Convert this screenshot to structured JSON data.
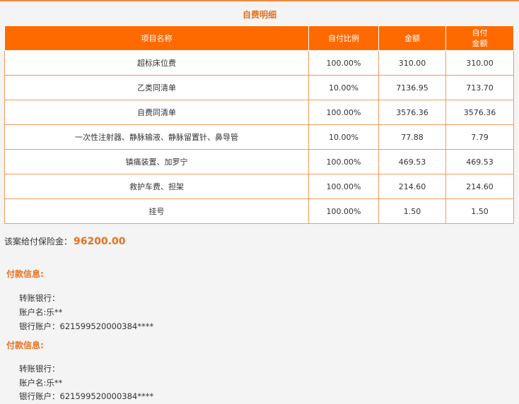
{
  "section_title": "自费明细",
  "table": {
    "headers": {
      "item": "项目名称",
      "ratio": "自付比例",
      "amount": "金额",
      "self_pay_line1": "自付",
      "self_pay_line2": "金额"
    },
    "rows": [
      {
        "item": "超标床位费",
        "ratio": "100.00%",
        "amount": "310.00",
        "self_pay": "310.00"
      },
      {
        "item": "乙类同清单",
        "ratio": "10.00%",
        "amount": "7136.95",
        "self_pay": "713.70"
      },
      {
        "item": "自费同清单",
        "ratio": "100.00%",
        "amount": "3576.36",
        "self_pay": "3576.36"
      },
      {
        "item": "一次性注射器、静脉输液、静脉留置针、鼻导管",
        "ratio": "10.00%",
        "amount": "77.88",
        "self_pay": "7.79"
      },
      {
        "item": "镇痛装置、加罗宁",
        "ratio": "100.00%",
        "amount": "469.53",
        "self_pay": "469.53"
      },
      {
        "item": "救护车费、担架",
        "ratio": "100.00%",
        "amount": "214.60",
        "self_pay": "214.60"
      },
      {
        "item": "挂号",
        "ratio": "100.00%",
        "amount": "1.50",
        "self_pay": "1.50"
      }
    ]
  },
  "payout": {
    "label": "该案给付保险金：",
    "amount": "96200.00"
  },
  "payment_blocks": [
    {
      "title": "付款信息:",
      "bank": "转账银行：",
      "account_name": "账户名:乐**",
      "account_no": "银行账户：621599520000384****"
    },
    {
      "title": "付款信息:",
      "bank": "转账银行：",
      "account_name": "账户名:乐**",
      "account_no": "银行账户：621599520000384****"
    }
  ],
  "colors": {
    "accent": "#ff6a00",
    "accent_text": "#e8711f",
    "border": "#f39a5b"
  }
}
